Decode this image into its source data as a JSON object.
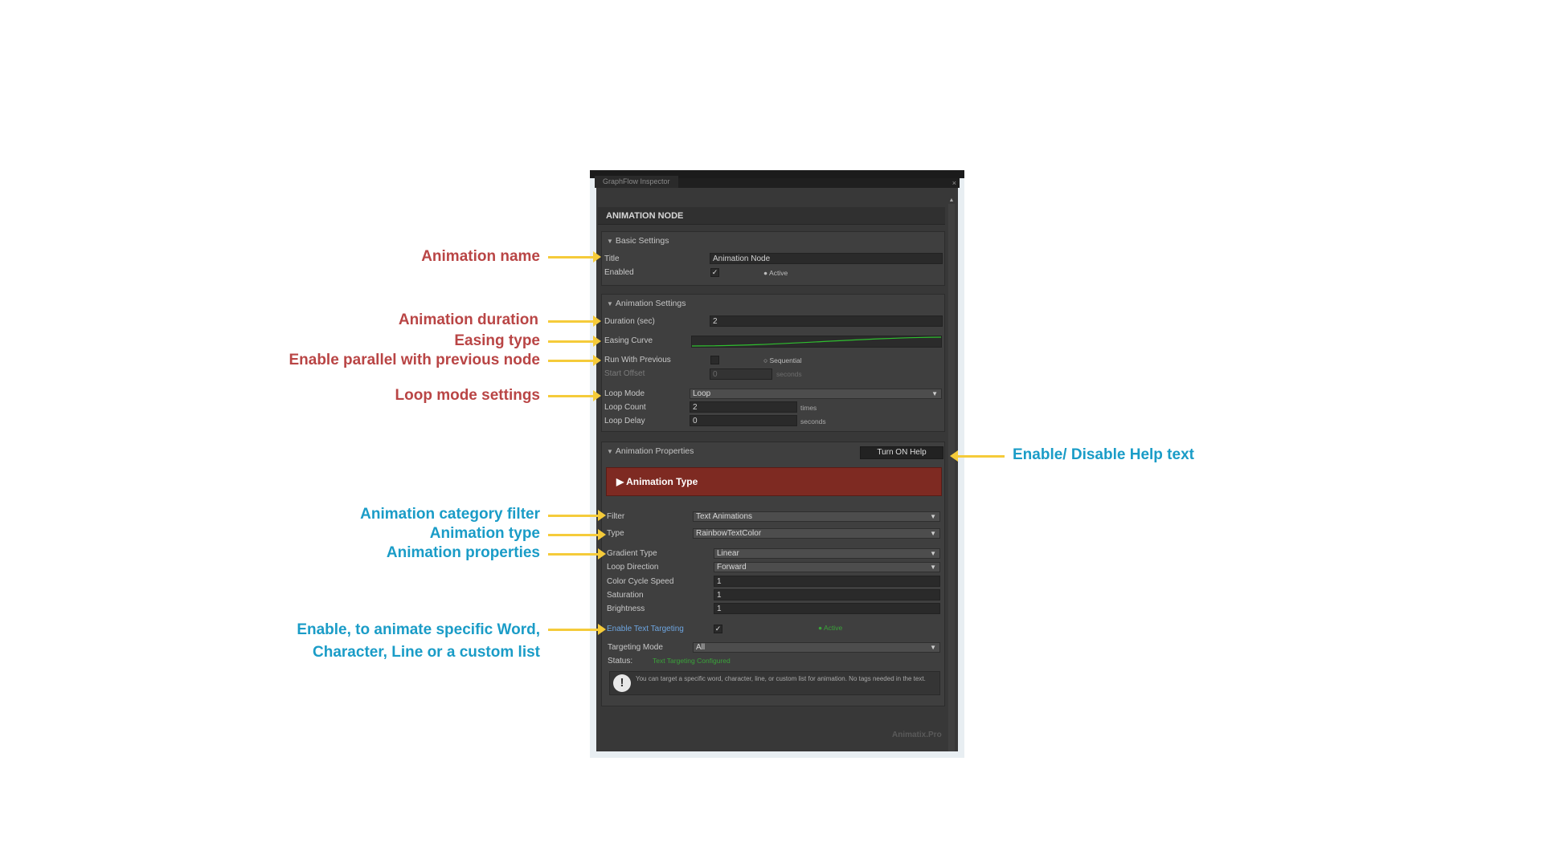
{
  "inspector": {
    "tab_title": "GraphFlow Inspector",
    "close_glyph": "×",
    "node_header": "ANIMATION NODE",
    "watermark": "Animatix.Pro"
  },
  "basic_settings": {
    "header": "Basic Settings",
    "title_label": "Title",
    "title_value": "Animation Node",
    "enabled_label": "Enabled",
    "enabled_checked": true,
    "status_text": "Active"
  },
  "animation_settings": {
    "header": "Animation Settings",
    "duration_label": "Duration (sec)",
    "duration_value": "2",
    "easing_label": "Easing Curve",
    "easing_curve_color": "#2fbf2f",
    "run_with_previous_label": "Run With Previous",
    "run_with_previous_checked": false,
    "mode_text": "Sequential",
    "start_offset_label": "Start Offset",
    "start_offset_value": "0",
    "start_offset_unit": "seconds",
    "loop_mode_label": "Loop Mode",
    "loop_mode_value": "Loop",
    "loop_count_label": "Loop Count",
    "loop_count_value": "2",
    "loop_count_unit": "times",
    "loop_delay_label": "Loop Delay",
    "loop_delay_value": "0",
    "loop_delay_unit": "seconds"
  },
  "animation_properties": {
    "header": "Animation Properties",
    "help_button": "Turn ON Help",
    "anim_type_label": "Animation Type",
    "filter_label": "Filter",
    "filter_value": "Text Animations",
    "type_label": "Type",
    "type_value": "RainbowTextColor",
    "gradient_type_label": "Gradient Type",
    "gradient_type_value": "Linear",
    "loop_direction_label": "Loop Direction",
    "loop_direction_value": "Forward",
    "color_cycle_speed_label": "Color Cycle Speed",
    "color_cycle_speed_value": "1",
    "saturation_label": "Saturation",
    "saturation_value": "1",
    "brightness_label": "Brightness",
    "brightness_value": "1",
    "text_targeting_label": "Enable Text Targeting",
    "text_targeting_checked": true,
    "text_targeting_status": "Active",
    "targeting_mode_label": "Targeting Mode",
    "targeting_mode_value": "All",
    "status_label": "Status:",
    "status_value": "Text Targeting Configured",
    "info_text": "You can target a specific word, character, line, or custom list for animation. No tags needed in the text."
  },
  "annotations": {
    "animation_name": "Animation name",
    "animation_duration": "Animation duration",
    "easing_type": "Easing type",
    "parallel": "Enable parallel with previous node",
    "loop_mode": "Loop mode settings",
    "help_toggle": "Enable/ Disable Help text",
    "category_filter": "Animation category filter",
    "animation_type": "Animation type",
    "animation_properties": "Animation properties",
    "text_targeting_line1": "Enable, to animate specific Word,",
    "text_targeting_line2": "Character, Line or a custom list"
  },
  "colors": {
    "annotation_red": "#b94545",
    "annotation_blue": "#1a9cc7",
    "arrow_yellow": "#f5cb3a",
    "animation_type_bar": "#7e2a22",
    "active_green": "#3aa33a",
    "link_blue": "#6da5e0"
  },
  "icons": {
    "info": "exclamation-circle-icon",
    "checkbox": "checkmark-icon",
    "dropdown": "chevron-down-icon",
    "foldout": "triangle-down-icon",
    "expand": "triangle-right-icon"
  }
}
